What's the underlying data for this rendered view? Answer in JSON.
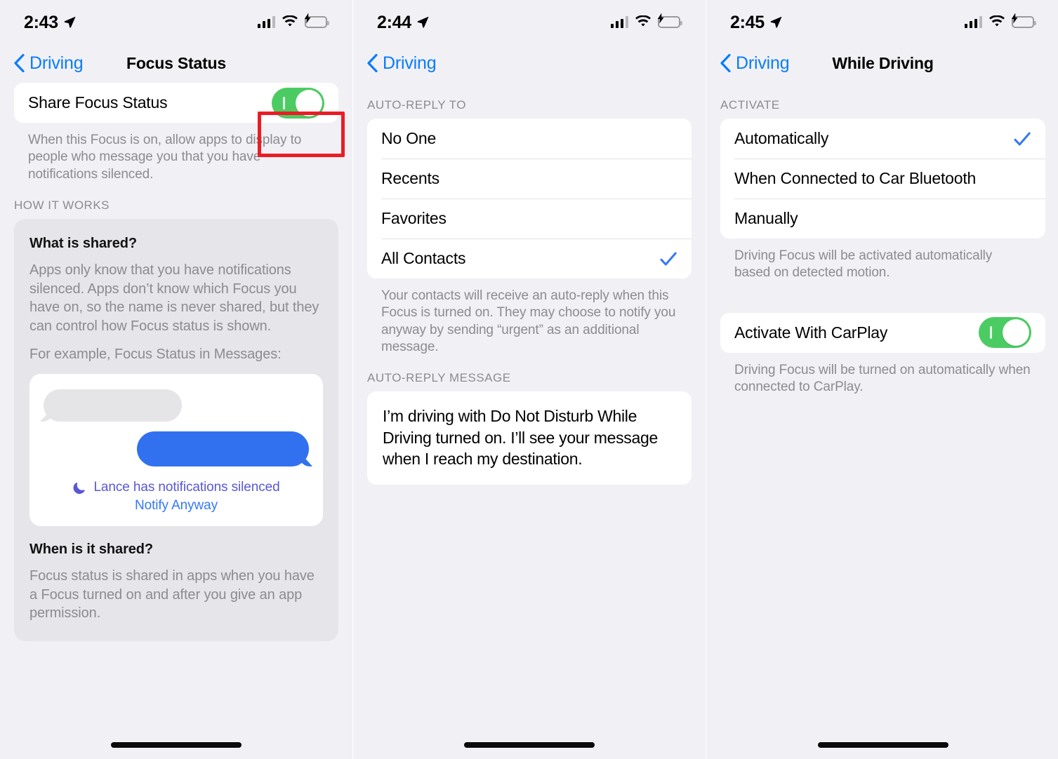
{
  "screens": [
    {
      "status": {
        "time": "2:43",
        "location_icon": "location-arrow-icon",
        "cellular_icon": "cellular-bars-icon",
        "wifi_icon": "wifi-icon",
        "battery_icon": "battery-charging-icon"
      },
      "nav": {
        "back_label": "Driving",
        "title": "Focus Status"
      },
      "toggle_row": {
        "label": "Share Focus Status",
        "value": "on"
      },
      "toggle_footnote": "When this Focus is on, allow apps to display to people who message you that you have notifications silenced.",
      "section_header": "HOW IT WORKS",
      "hiw": {
        "q1_title": "What is shared?",
        "q1_body": "Apps only know that you have notifications silenced. Apps don’t know which Focus you have on, so the name is never shared, but they can control how Focus status is shown.",
        "q1_example": "For example, Focus Status in Messages:",
        "mock": {
          "silenced_text": "Lance has notifications silenced",
          "notify_anyway": "Notify Anyway",
          "moon_icon": "crescent-moon-icon"
        },
        "q2_title": "When is it shared?",
        "q2_body": "Focus status is shared in apps when you have a Focus turned on and after you give an app permission."
      },
      "annotation": {
        "type": "red-rectangle-highlight",
        "color": "#ec1c24",
        "target": "share-focus-status-toggle"
      }
    },
    {
      "status": {
        "time": "2:44",
        "location_icon": "location-arrow-icon",
        "cellular_icon": "cellular-bars-icon",
        "wifi_icon": "wifi-icon",
        "battery_icon": "battery-charging-icon"
      },
      "nav": {
        "back_label": "Driving",
        "title": ""
      },
      "section_header": "AUTO-REPLY TO",
      "options": [
        {
          "label": "No One",
          "selected": false
        },
        {
          "label": "Recents",
          "selected": false
        },
        {
          "label": "Favorites",
          "selected": false
        },
        {
          "label": "All Contacts",
          "selected": true
        }
      ],
      "footnote": "Your contacts will receive an auto-reply when this Focus is turned on. They may choose to notify you anyway by sending “urgent” as an additional message.",
      "message_header": "AUTO-REPLY MESSAGE",
      "message_value": "I’m driving with Do Not Disturb While Driving turned on. I’ll see your message when I reach my destination."
    },
    {
      "status": {
        "time": "2:45",
        "location_icon": "location-arrow-icon",
        "cellular_icon": "cellular-bars-icon",
        "wifi_icon": "wifi-icon",
        "battery_icon": "battery-charging-icon"
      },
      "nav": {
        "back_label": "Driving",
        "title": "While Driving"
      },
      "section_header": "ACTIVATE",
      "options": [
        {
          "label": "Automatically",
          "selected": true
        },
        {
          "label": "When Connected to Car Bluetooth",
          "selected": false
        },
        {
          "label": "Manually",
          "selected": false
        }
      ],
      "footnote": "Driving Focus will be activated automatically based on detected motion.",
      "toggle_row": {
        "label": "Activate With CarPlay",
        "value": "on"
      },
      "toggle_footnote": "Driving Focus will be turned on automatically when connected to CarPlay."
    }
  ],
  "colors": {
    "accent_blue": "#0a7bff",
    "toggle_green": "#4bcc63",
    "annotation_red": "#ec1c24",
    "purple": "#5957d6",
    "bubble_blue": "#3171f0",
    "page_bg": "#f1f1f5",
    "card_bg": "#ffffff"
  }
}
